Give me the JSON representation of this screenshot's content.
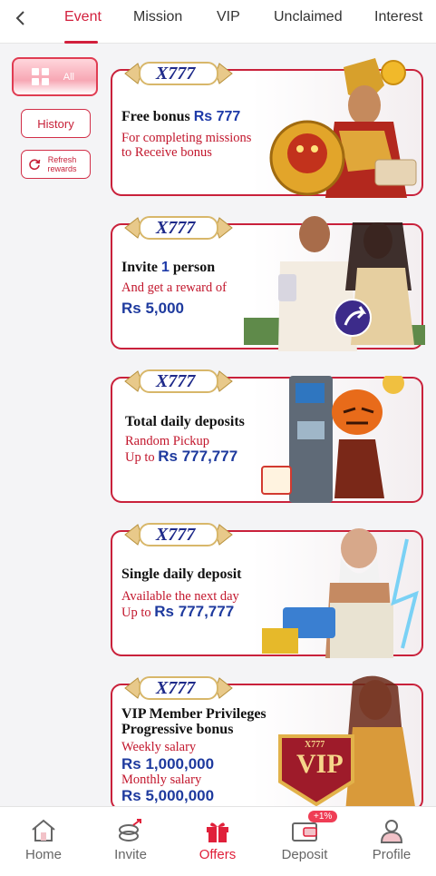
{
  "tabs": [
    "Event",
    "Mission",
    "VIP",
    "Unclaimed",
    "Interest"
  ],
  "sidebar": {
    "all_label": "All",
    "history_label": "History",
    "refresh_label": "Refresh rewards"
  },
  "brand": "X777",
  "cards": [
    {
      "line1": "Free bonus ",
      "line1_value": "Rs 777",
      "sub1": "For completing missions",
      "sub2": "to Receive bonus"
    },
    {
      "line1": "Invite ",
      "line1_value": "1",
      "line1_end": " person",
      "sub1": "And get a reward of",
      "amount1": "Rs 5,000"
    },
    {
      "line1": "Total daily deposits",
      "sub1": "Random Pickup",
      "sub2_prefix": "Up to ",
      "amount1": "Rs 777,777"
    },
    {
      "line1": "Single daily deposit",
      "sub1": "Available the next day",
      "sub2_prefix": "Up to ",
      "amount1": "Rs 777,777"
    },
    {
      "line1": "VIP Member Privileges",
      "line2": "Progressive bonus",
      "sub1": "Weekly salary",
      "amount1": "Rs 1,000,000",
      "sub2": "Monthly salary",
      "amount2": "Rs 5,000,000",
      "vip_badge": "VIP",
      "vip_badge_top": "X777"
    }
  ],
  "bottom_nav": [
    {
      "label": "Home",
      "icon": "home-icon"
    },
    {
      "label": "Invite",
      "icon": "invite-icon"
    },
    {
      "label": "Offers",
      "icon": "gift-icon"
    },
    {
      "label": "Deposit",
      "icon": "wallet-icon",
      "badge": "+1%"
    },
    {
      "label": "Profile",
      "icon": "profile-icon"
    }
  ],
  "colors": {
    "accent": "#d21f3c",
    "amount_blue": "#1e3a9e",
    "card_border": "#c9213b"
  }
}
